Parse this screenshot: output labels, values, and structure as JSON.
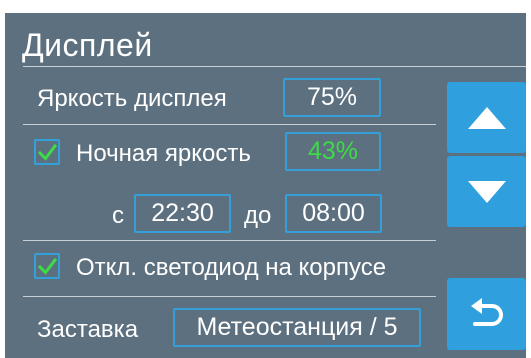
{
  "screen": {
    "title": "Дисплей",
    "brightness": {
      "label": "Яркость дисплея",
      "value": "75%"
    },
    "night_brightness": {
      "label": "Ночная яркость",
      "value": "43%",
      "checked": true,
      "value_color": "#3ddb47"
    },
    "schedule": {
      "from_label": "с",
      "from_value": "22:30",
      "to_label": "до",
      "to_value": "08:00"
    },
    "led_off": {
      "label": "Откл. светодиод на корпусе",
      "checked": true
    },
    "screensaver": {
      "label": "Заставка",
      "value": "Метеостанция / 5"
    }
  },
  "buttons": {
    "up": "arrow-up-icon",
    "down": "arrow-down-icon",
    "back": "back-arrow-icon"
  },
  "colors": {
    "background": "#5d707f",
    "accent": "#2f9fde",
    "check": "#3ddb47",
    "text": "#ffffff"
  }
}
